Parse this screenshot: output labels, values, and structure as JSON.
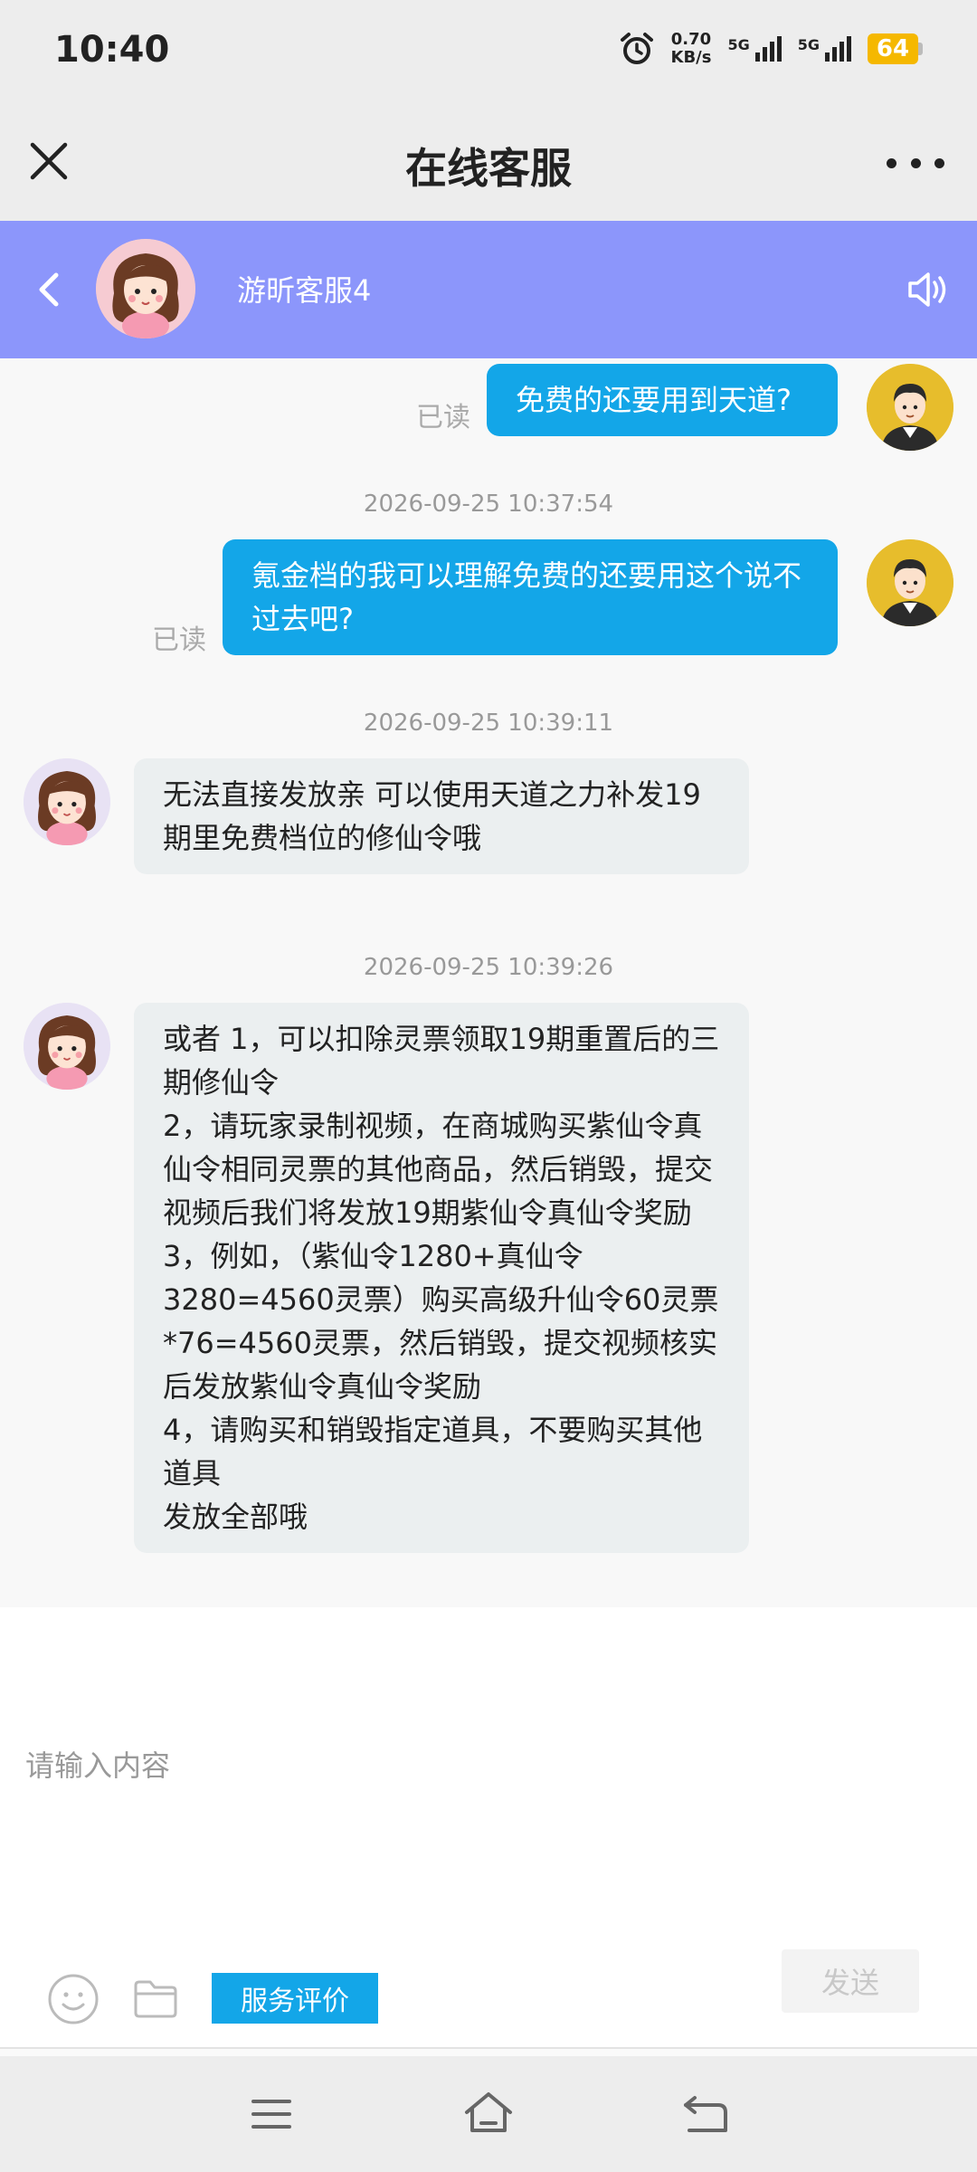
{
  "status_bar": {
    "time": "10:40",
    "net_speed_value": "0.70",
    "net_speed_unit": "KB/s",
    "sim1_label": "5G",
    "sim2_label": "5G",
    "battery_level": "64"
  },
  "header": {
    "title": "在线客服"
  },
  "agent": {
    "name": "游昕客服4"
  },
  "messages": [
    {
      "direction": "outgoing",
      "text": "免费的还要用到天道?",
      "read_label": "已读"
    },
    {
      "timestamp": "2026-09-25 10:37:54"
    },
    {
      "direction": "outgoing",
      "text": "氪金档的我可以理解免费的还要用这个说不过去吧?",
      "read_label": "已读"
    },
    {
      "timestamp": "2026-09-25 10:39:11"
    },
    {
      "direction": "incoming",
      "text": "无法直接发放亲 可以使用天道之力补发19期里免费档位的修仙令哦"
    },
    {
      "timestamp": "2026-09-25 10:39:26"
    },
    {
      "direction": "incoming",
      "text": "或者 1，可以扣除灵票领取19期重置后的三期修仙令\n2，请玩家录制视频，在商城购买紫仙令真仙令相同灵票的其他商品，然后销毁，提交视频后我们将发放19期紫仙令真仙令奖励\n3，例如，（紫仙令1280+真仙令3280=4560灵票）购买高级升仙令60灵票*76=4560灵票，然后销毁，提交视频核实后发放紫仙令真仙令奖励\n4，请购买和销毁指定道具，不要购买其他道具\n发放全部哦"
    }
  ],
  "input": {
    "placeholder": "请输入内容",
    "value": ""
  },
  "toolbar": {
    "rate_label": "服务评价",
    "send_label": "发送"
  },
  "colors": {
    "accent": "#13a6e8",
    "agent_header": "#8c96fb",
    "battery": "#f5b800"
  }
}
